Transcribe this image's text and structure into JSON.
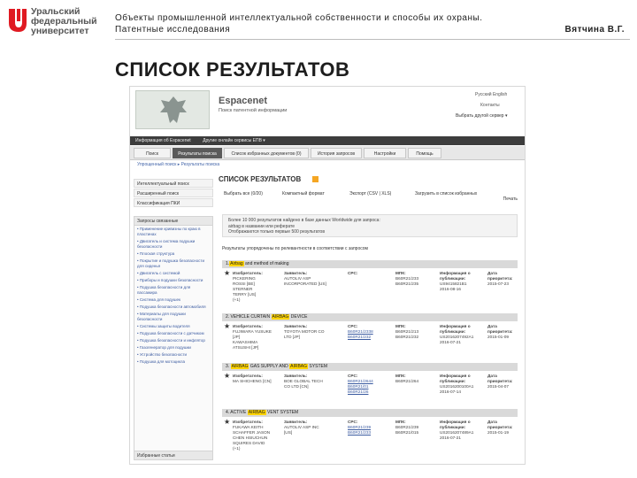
{
  "header": {
    "university_lines": [
      "Уральский",
      "федеральный",
      "университет"
    ],
    "course_line1": "Объекты промышленной интеллектуальной собственности и способы их охраны.",
    "course_line2": "Патентные исследования",
    "author": "Вятчина В.Г.",
    "slide_title": "СПИСОК РЕЗУЛЬТАТОВ"
  },
  "espacenet": {
    "name": "Espacenet",
    "subtitle": "Поиск патентной информации",
    "lang": "Русский  English",
    "contacts": "Контакты",
    "country": "Выбрать другой сервер ▾",
    "info_bar": [
      "Информация об Espacenet",
      "Другие онлайн сервисы ЕПВ ▾"
    ],
    "nav_tabs": [
      "Поиск",
      "Результаты поиска",
      "Список избранных документов (0)",
      "История запросов",
      "Настройки",
      "Помощь"
    ],
    "breadcrumbs": "Упрощенный поиск ▸ Результаты поиска",
    "side_links": [
      "Интеллектуальный поиск",
      "Расширенный поиск",
      "Классификация ПКИ"
    ],
    "side_panel_title": "Запросы связанные",
    "side_items": [
      "• Применение кривизны по краю в пластинах",
      "• Двигатель и система подушки безопасности",
      "• Плоская структура",
      "• Покрытие и подушка безопасности для сиденья",
      "• Двигатель с системой",
      "• Приборы и подушки безопасности",
      "• Подушка безопасности для пассажира",
      "• Система для подушек",
      "• Подушка безопасности автомобиля",
      "• Материалы для подушки безопасности",
      "• Системы защиты водителя",
      "• Подушка безопасности с датчиком",
      "• Подушка безопасности и инфлятор",
      "• Газогенератор для подушки",
      "• Устройство безопасности",
      "• Подушка для мотоцикла"
    ],
    "side_bottom": "Избранные статьи",
    "results_title": "СПИСОК РЕЗУЛЬТАТОВ",
    "toolbar": [
      "Выбрать все (0/20)",
      "Компактный формат",
      "Экспорт (CSV | XLS)",
      "Загрузить в список избранных"
    ],
    "print": "Печать",
    "notice_lines": [
      "Более 10 000 результатов найдено в базе данных Worldwide для запроса:",
      "airbag в названии или реферате",
      "Отображаются только первые 500 результатов"
    ],
    "hits": "Результаты упорядочены по релевантности в соответствии с запросом",
    "results": [
      {
        "pre": "1.",
        "hl1": "Airbag",
        "post": " and method of making",
        "col_labels": [
          "Изобретатель:",
          "Заявитель:",
          "CPC:",
          "МПК:",
          "Информация о публикации:",
          "Дата приоритета:"
        ],
        "inventors": "PICKERING\nROSSI [BE]\nSTERNER\nTERRY [US]\n(+1)",
        "applicants": "AUTOLIV ASP\nINCORPORATED [US]",
        "cpc": "",
        "ipc": "B60R21/233\nB60R21/235",
        "pub": "US9415821B1\n2016-08-16",
        "prio": "2015-07-23"
      },
      {
        "pre": "2. VEHICLE CURTAIN ",
        "hl1": "AIRBAG",
        "post": " DEVICE",
        "col_labels": [
          "Изобретатель:",
          "Заявитель:",
          "CPC:",
          "МПК:",
          "Информация о публикации:",
          "Дата приоритета:"
        ],
        "inventors": "FUJIWARA YUSUKE\n[JP]\nKAWASHIMA\nATSUSHI [JP]",
        "applicants": "TOYOTA MOTOR CO\nLTD [JP]",
        "cpc": "B60R21/2338\nB60R21/232",
        "ipc": "B60R21/213\nB60R21/232",
        "pub": "US2016207492A1\n2016-07-21",
        "prio": "2015-01-09"
      },
      {
        "pre": "3. ",
        "hl1": "AIRBAG",
        "post": " GAS SUPPLY AND ",
        "hl2": "AIRBAG",
        "post2": " SYSTEM",
        "col_labels": [
          "Изобретатель:",
          "Заявитель:",
          "CPC:",
          "МПК:",
          "Информация о публикации:",
          "Дата приоритета:"
        ],
        "inventors": "MA SHICHENG [CN]",
        "applicants": "BOE GLOBAL TECH\nCO LTD [CN]",
        "cpc": "B60R21/2644\nB60R21/01\nB60R21/26",
        "ipc": "B60R21/264",
        "pub": "US2016200100A1\n2016-07-14",
        "prio": "2015-04-07"
      },
      {
        "pre": "4. ACTIVE ",
        "hl1": "AIRBAG",
        "post": " VENT SYSTEM",
        "col_labels": [
          "Изобретатель:",
          "Заявитель:",
          "CPC:",
          "МПК:",
          "Информация о публикации:",
          "Дата приоритета:"
        ],
        "inventors": "FUKAWA KEITH\nSCHAFFER JASON\nCHEN HSIUCHUN\nSQUIRES DAVID\n(+1)",
        "applicants": "AUTOLIV ASP INC\n[US]",
        "cpc": "B60R21/239\nB60R21/233",
        "ipc": "B60R21/239\nB60R21/015",
        "pub": "US2016207489A1\n2016-07-21",
        "prio": "2015-01-19"
      }
    ]
  }
}
